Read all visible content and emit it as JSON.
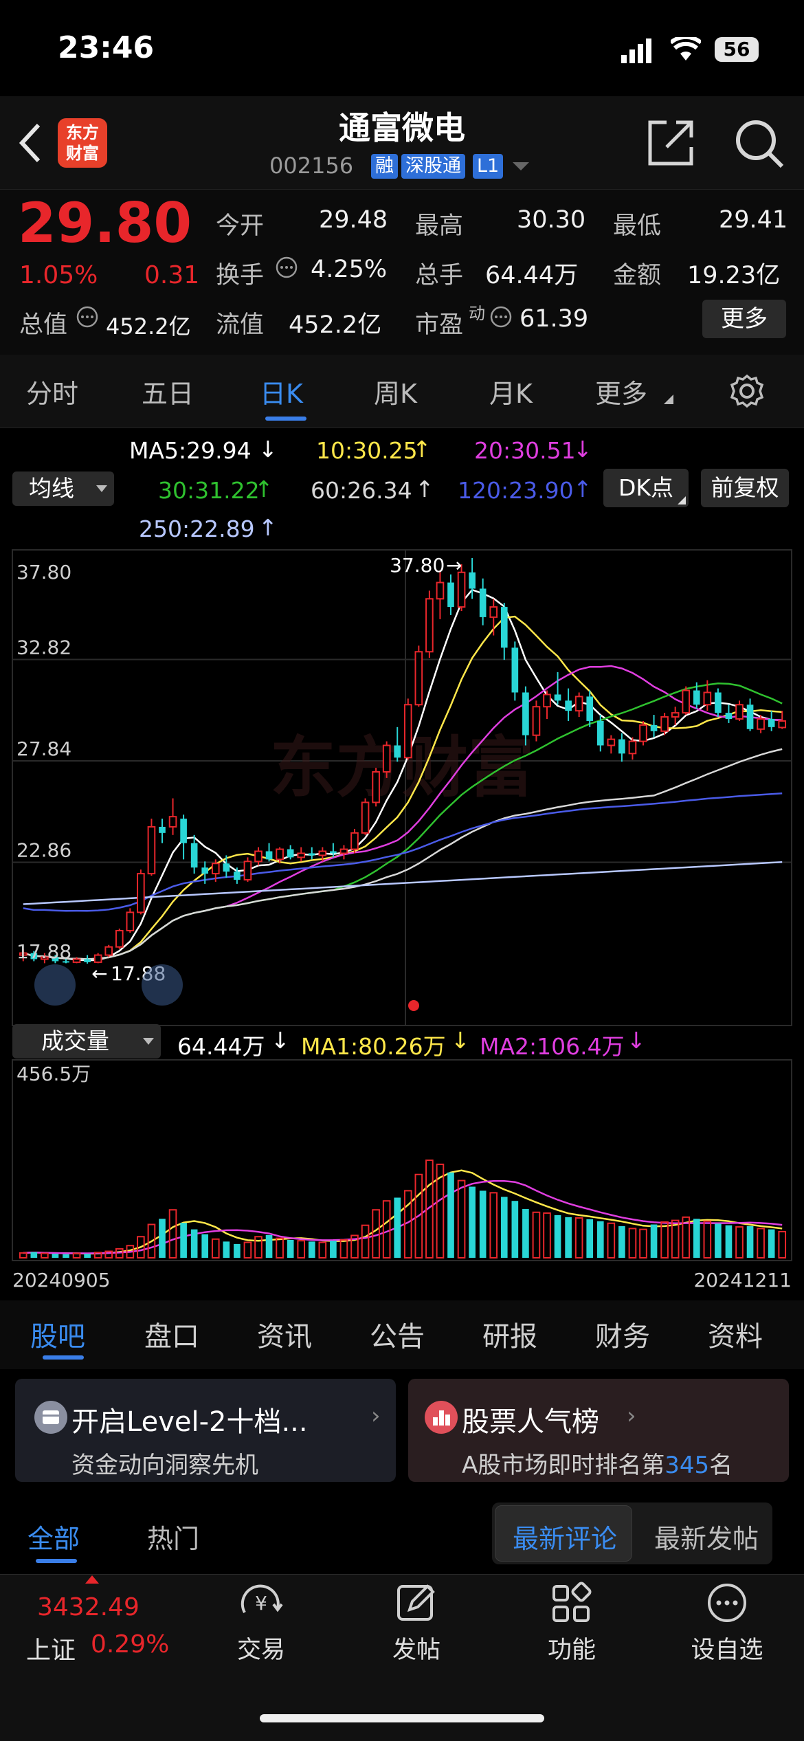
{
  "status_bar": {
    "time": "23:46",
    "battery": "56"
  },
  "header": {
    "logo_line1": "东方",
    "logo_line2": "财富",
    "title": "通富微电",
    "code": "002156",
    "tags": [
      "融",
      "深股通",
      "L1"
    ]
  },
  "quote": {
    "price": "29.80",
    "change_pct": "1.05%",
    "change": "0.31",
    "open_label": "今开",
    "open": "29.48",
    "high_label": "最高",
    "high": "30.30",
    "low_label": "最低",
    "low": "29.41",
    "turnover_label": "换手",
    "turnover": "4.25%",
    "volume_label": "总手",
    "volume": "64.44万",
    "amount_label": "金额",
    "amount": "19.23亿",
    "mktcap_label": "总值",
    "mktcap": "452.2亿",
    "float_label": "流值",
    "float": "452.2亿",
    "pe_label": "市盈",
    "pe_sup": "动",
    "pe": "61.39",
    "more_label": "更多"
  },
  "chart_tabs": {
    "items": [
      "分时",
      "五日",
      "日K",
      "周K",
      "月K",
      "更多"
    ],
    "active": "日K"
  },
  "ma": {
    "selector": "均线",
    "ma5": "MA5:29.94",
    "ma10": "10:30.25",
    "ma20": "20:30.51",
    "ma30": "30:31.22",
    "ma60": "60:26.34",
    "ma120": "120:23.90",
    "ma250": "250:22.89",
    "dk_button": "DK点",
    "adjust_button": "前复权",
    "colors": {
      "ma5": "#ffffff",
      "ma10": "#ffe74a",
      "ma20": "#e03ee0",
      "ma30": "#2fc12f",
      "ma60": "#d8d8d8",
      "ma120": "#4a5be8",
      "ma250": "#b8c8ff"
    }
  },
  "volume_bar": {
    "selector": "成交量",
    "vol": "64.44万",
    "ma1": "MA1:80.26万",
    "ma2": "MA2:106.4万"
  },
  "chart_data": {
    "type": "candlestick",
    "price_ticks": [
      "37.80",
      "32.82",
      "27.84",
      "22.86",
      "17.88"
    ],
    "y_range": [
      17.88,
      37.8
    ],
    "max_label": "37.80",
    "min_label": "17.88",
    "volume_max_label": "456.5万",
    "start_date": "20240905",
    "end_date": "20241211",
    "watermark": "东方财富",
    "candles": [
      [
        18.3,
        18.6,
        18.0,
        18.4
      ],
      [
        18.4,
        18.5,
        18.0,
        18.1
      ],
      [
        18.1,
        18.4,
        17.9,
        18.2
      ],
      [
        18.2,
        18.3,
        17.9,
        18.0
      ],
      [
        18.0,
        18.1,
        17.9,
        17.95
      ],
      [
        17.95,
        18.2,
        17.9,
        18.1
      ],
      [
        18.1,
        18.3,
        17.88,
        17.95
      ],
      [
        17.95,
        18.4,
        17.9,
        18.3
      ],
      [
        18.3,
        18.8,
        18.2,
        18.7
      ],
      [
        18.7,
        19.6,
        18.6,
        19.5
      ],
      [
        19.5,
        20.6,
        19.4,
        20.4
      ],
      [
        20.4,
        22.5,
        20.3,
        22.3
      ],
      [
        22.3,
        25.0,
        22.2,
        24.6
      ],
      [
        24.6,
        25.0,
        23.8,
        24.3
      ],
      [
        24.6,
        26.0,
        24.2,
        25.1
      ],
      [
        25.0,
        25.2,
        23.0,
        23.8
      ],
      [
        23.8,
        24.2,
        22.3,
        22.6
      ],
      [
        22.6,
        22.9,
        21.8,
        22.3
      ],
      [
        22.3,
        23.0,
        21.9,
        22.8
      ],
      [
        22.8,
        23.2,
        22.1,
        22.4
      ],
      [
        22.4,
        22.6,
        21.8,
        22.0
      ],
      [
        22.0,
        23.1,
        21.9,
        22.9
      ],
      [
        22.9,
        23.6,
        22.7,
        23.4
      ],
      [
        23.4,
        23.8,
        22.9,
        23.0
      ],
      [
        23.0,
        23.6,
        22.8,
        23.5
      ],
      [
        23.5,
        23.7,
        23.0,
        23.1
      ],
      [
        23.1,
        23.6,
        22.9,
        23.3
      ],
      [
        23.3,
        23.6,
        23.0,
        23.2
      ],
      [
        23.2,
        23.6,
        22.9,
        23.4
      ],
      [
        23.4,
        23.8,
        23.1,
        23.3
      ],
      [
        23.3,
        23.7,
        23.0,
        23.5
      ],
      [
        23.5,
        24.5,
        23.3,
        24.3
      ],
      [
        24.3,
        26.0,
        24.2,
        25.8
      ],
      [
        25.8,
        27.5,
        25.6,
        27.3
      ],
      [
        27.3,
        28.8,
        27.0,
        28.6
      ],
      [
        28.6,
        29.5,
        27.8,
        28.0
      ],
      [
        28.0,
        30.9,
        27.9,
        30.6
      ],
      [
        30.6,
        33.5,
        30.5,
        33.2
      ],
      [
        33.2,
        36.2,
        32.9,
        35.8
      ],
      [
        35.8,
        37.2,
        34.8,
        36.6
      ],
      [
        36.6,
        37.0,
        35.0,
        35.4
      ],
      [
        35.4,
        37.5,
        35.2,
        37.1
      ],
      [
        37.1,
        37.8,
        35.8,
        36.3
      ],
      [
        36.3,
        36.8,
        34.5,
        34.9
      ],
      [
        34.9,
        35.8,
        34.0,
        35.4
      ],
      [
        35.4,
        35.6,
        32.8,
        33.4
      ],
      [
        33.4,
        33.7,
        30.8,
        31.2
      ],
      [
        31.2,
        31.5,
        28.6,
        29.1
      ],
      [
        29.1,
        30.8,
        28.8,
        30.5
      ],
      [
        30.5,
        31.3,
        29.9,
        31.1
      ],
      [
        31.1,
        32.2,
        30.6,
        30.8
      ],
      [
        30.8,
        31.4,
        29.8,
        30.3
      ],
      [
        30.3,
        31.2,
        30.0,
        31.0
      ],
      [
        31.0,
        31.3,
        29.5,
        29.8
      ],
      [
        29.8,
        30.1,
        28.3,
        28.6
      ],
      [
        28.6,
        29.1,
        28.2,
        28.9
      ],
      [
        28.9,
        29.2,
        27.8,
        28.2
      ],
      [
        28.2,
        29.0,
        27.9,
        28.8
      ],
      [
        28.8,
        29.8,
        28.6,
        29.6
      ],
      [
        29.6,
        30.1,
        29.0,
        29.3
      ],
      [
        29.3,
        30.2,
        29.1,
        30.0
      ],
      [
        30.0,
        30.5,
        29.6,
        30.2
      ],
      [
        30.2,
        31.5,
        30.1,
        31.3
      ],
      [
        31.3,
        31.7,
        30.4,
        30.6
      ],
      [
        30.6,
        31.8,
        30.3,
        31.2
      ],
      [
        31.2,
        31.4,
        30.0,
        30.2
      ],
      [
        30.2,
        30.6,
        29.7,
        29.9
      ],
      [
        29.9,
        30.8,
        29.8,
        30.6
      ],
      [
        30.6,
        30.9,
        29.3,
        29.4
      ],
      [
        29.4,
        30.1,
        29.2,
        29.9
      ],
      [
        29.9,
        30.3,
        29.3,
        29.5
      ],
      [
        29.48,
        30.3,
        29.41,
        29.8
      ]
    ],
    "volume": [
      12,
      14,
      11,
      10,
      9,
      11,
      10,
      13,
      16,
      22,
      30,
      52,
      82,
      96,
      118,
      86,
      70,
      58,
      46,
      40,
      34,
      38,
      52,
      56,
      48,
      44,
      42,
      40,
      38,
      42,
      44,
      55,
      80,
      118,
      140,
      148,
      165,
      205,
      240,
      230,
      210,
      190,
      175,
      165,
      160,
      150,
      140,
      120,
      112,
      110,
      105,
      100,
      98,
      95,
      90,
      85,
      78,
      72,
      70,
      82,
      88,
      92,
      100,
      96,
      90,
      84,
      80,
      76,
      78,
      72,
      70,
      64.44
    ]
  },
  "sub_tabs": {
    "items": [
      "股吧",
      "盘口",
      "资讯",
      "公告",
      "研报",
      "财务",
      "资料"
    ],
    "active": "股吧"
  },
  "cards": {
    "level2_title": "开启Level-2十档...",
    "level2_sub": "资金动向洞察先机",
    "rank_title": "股票人气榜",
    "rank_sub_prefix": "A股市场即时排名第",
    "rank_num": "345",
    "rank_sub_suffix": "名"
  },
  "feed": {
    "tabs": [
      "全部",
      "热门"
    ],
    "active": "全部",
    "sort_latest_comment": "最新评论",
    "sort_latest_post": "最新发帖"
  },
  "bottom_nav": {
    "index_value": "3432.49",
    "index_name": "上证",
    "index_change": "0.29%",
    "trade": "交易",
    "post": "发帖",
    "func": "功能",
    "watch": "设自选"
  }
}
